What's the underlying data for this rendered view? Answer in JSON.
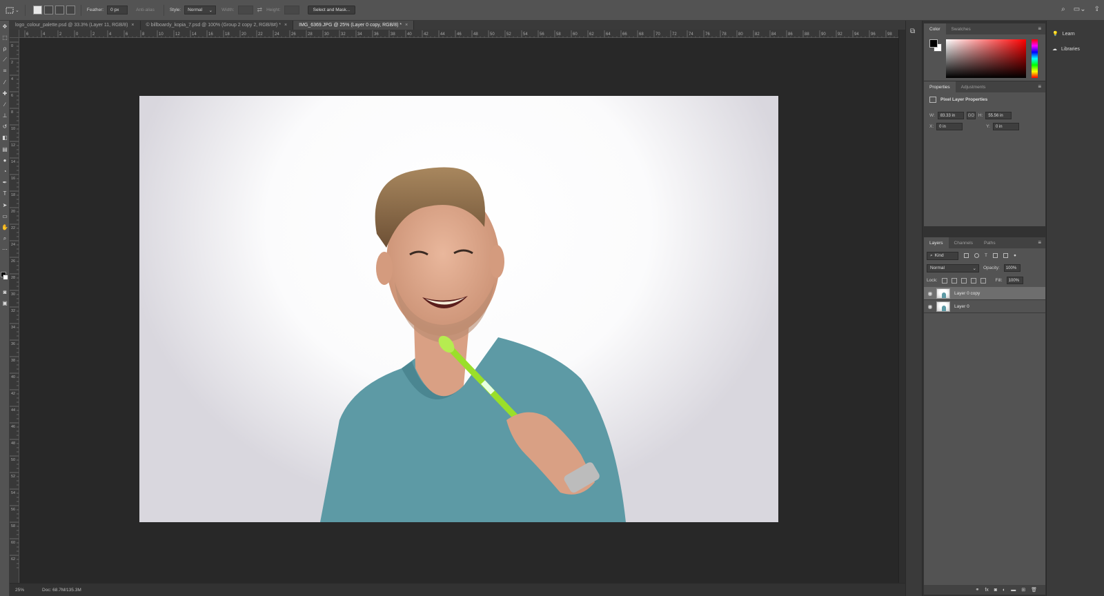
{
  "options_bar": {
    "feather_label": "Feather:",
    "feather_value": "0 px",
    "antialias_label": "Anti-alias",
    "style_label": "Style:",
    "style_value": "Normal",
    "width_label": "Width:",
    "height_label": "Height:",
    "select_mask_label": "Select and Mask..."
  },
  "tabs": [
    {
      "label": "logo_colour_palette.psd @ 33.3% (Layer 11, RGB/8)",
      "close": "×"
    },
    {
      "label": "© billboardy_kopia_7.psd @ 100% (Group 2 copy 2, RGB/8#) *",
      "close": "×"
    },
    {
      "label": "IMG_6369.JPG @ 25% (Layer 0 copy, RGB/8) *",
      "close": "×"
    }
  ],
  "color_panel": {
    "tabs": [
      "Color",
      "Swatches"
    ],
    "foreground": "#000000",
    "background": "#ffffff",
    "hue_color": "#ff0000"
  },
  "properties_panel": {
    "tabs": [
      "Properties",
      "Adjustments"
    ],
    "title": "Pixel Layer Properties",
    "w_label": "W:",
    "w_value": "83.33 in",
    "h_label": "H:",
    "h_value": "55.56 in",
    "x_label": "X:",
    "x_value": "0 in",
    "y_label": "Y:",
    "y_value": "0 in",
    "link_glyph": "GO"
  },
  "layers_panel": {
    "tabs": [
      "Layers",
      "Channels",
      "Paths"
    ],
    "kind_label": "Kind",
    "blend_mode": "Normal",
    "opacity_label": "Opacity:",
    "opacity_value": "100%",
    "lock_label": "Lock:",
    "fill_label": "Fill:",
    "fill_value": "100%",
    "layers": [
      {
        "name": "Layer 0 copy",
        "selected": true,
        "visible": true
      },
      {
        "name": "Layer 0",
        "selected": false,
        "visible": true
      }
    ]
  },
  "learn_panel": {
    "items": [
      {
        "label": "Learn",
        "icon": "lightbulb-icon"
      },
      {
        "label": "Libraries",
        "icon": "libraries-icon"
      }
    ]
  },
  "status_bar": {
    "zoom": "25%",
    "doc_info": "Doc: 68.7M/135.3M"
  },
  "rulers": {
    "h_labels": [
      "6",
      "4",
      "2",
      "0",
      "2",
      "4",
      "6",
      "8",
      "10",
      "12",
      "14",
      "16",
      "18",
      "20",
      "22",
      "24",
      "26",
      "28",
      "30",
      "32",
      "34",
      "36",
      "38",
      "40",
      "42",
      "44",
      "46",
      "48",
      "50",
      "52",
      "54",
      "56",
      "58",
      "60",
      "62",
      "64",
      "66",
      "68",
      "70",
      "72",
      "74",
      "76",
      "78",
      "80",
      "82",
      "84",
      "86",
      "88",
      "90",
      "92",
      "94",
      "96",
      "98"
    ],
    "v_labels": [
      "0",
      "2",
      "4",
      "6",
      "8",
      "10",
      "12",
      "14",
      "16",
      "18",
      "20",
      "22",
      "24",
      "26",
      "28",
      "30",
      "32",
      "34",
      "36",
      "38",
      "40",
      "42",
      "44",
      "46",
      "48",
      "50",
      "52",
      "54",
      "56",
      "58",
      "60",
      "62"
    ]
  },
  "colors": {
    "accent_selected_layer": "#6e6e6e",
    "shirt": "#5d9aa5",
    "toothbrush": "#9adf2a"
  }
}
